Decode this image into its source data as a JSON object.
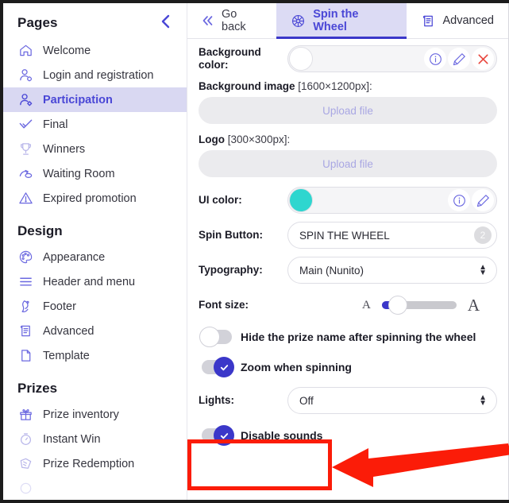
{
  "sidebar": {
    "title": "Pages",
    "collapse_icon": "chevron-left-icon",
    "groups": [
      {
        "title": "Pages",
        "items": [
          {
            "label": "Welcome",
            "icon": "home-icon",
            "active": false,
            "dim": false
          },
          {
            "label": "Login and registration",
            "icon": "user-gear-icon",
            "active": false,
            "dim": false
          },
          {
            "label": "Participation",
            "icon": "user-add-icon",
            "active": true,
            "dim": false
          },
          {
            "label": "Final",
            "icon": "check-icon",
            "active": false,
            "dim": false
          },
          {
            "label": "Winners",
            "icon": "trophy-icon",
            "active": false,
            "dim": true
          },
          {
            "label": "Waiting Room",
            "icon": "waiting-room-icon",
            "active": false,
            "dim": false
          },
          {
            "label": "Expired promotion",
            "icon": "warning-triangle-icon",
            "active": false,
            "dim": false
          }
        ]
      },
      {
        "title": "Design",
        "items": [
          {
            "label": "Appearance",
            "icon": "palette-icon",
            "active": false,
            "dim": false
          },
          {
            "label": "Header and menu",
            "icon": "menu-lines-icon",
            "active": false,
            "dim": false
          },
          {
            "label": "Footer",
            "icon": "footer-icon",
            "active": false,
            "dim": false
          },
          {
            "label": "Advanced",
            "icon": "scroll-icon",
            "active": false,
            "dim": false
          },
          {
            "label": "Template",
            "icon": "page-icon",
            "active": false,
            "dim": false
          }
        ]
      },
      {
        "title": "Prizes",
        "items": [
          {
            "label": "Prize inventory",
            "icon": "gift-icon",
            "active": false,
            "dim": false
          },
          {
            "label": "Instant Win",
            "icon": "stopwatch-icon",
            "active": false,
            "dim": true
          },
          {
            "label": "Prize Redemption",
            "icon": "ticket-icon",
            "active": false,
            "dim": true
          }
        ]
      }
    ]
  },
  "tabs": [
    {
      "label": "Go back",
      "icon": "double-chevron-left-icon",
      "active": false
    },
    {
      "label": "Spin the Wheel",
      "icon": "wheel-icon",
      "active": true
    },
    {
      "label": "Advanced",
      "icon": "scroll-icon",
      "active": false
    }
  ],
  "form": {
    "background_color": {
      "label": "Background color:",
      "swatch_hex": "#ffffff",
      "actions": [
        "info-icon",
        "edit-pencil-icon",
        "close-x-icon"
      ]
    },
    "background_image": {
      "label": "Background image",
      "dimensions": "[1600×1200px]:",
      "upload_text": "Upload file"
    },
    "logo": {
      "label": "Logo",
      "dimensions": "[300×300px]:",
      "upload_text": "Upload file"
    },
    "ui_color": {
      "label": "UI color:",
      "swatch_hex": "#2ed6cf",
      "actions": [
        "info-icon",
        "edit-pencil-icon"
      ]
    },
    "spin_button": {
      "label": "Spin Button:",
      "value": "SPIN THE WHEEL",
      "badge": "2"
    },
    "typography": {
      "label": "Typography:",
      "value": "Main (Nunito)"
    },
    "font_size": {
      "label": "Font size:",
      "small_glyph": "A",
      "large_glyph": "A",
      "percent": 12
    },
    "hide_prize_name": {
      "label": "Hide the prize name after spinning the wheel",
      "state": "off"
    },
    "zoom_when_spinning": {
      "label": "Zoom when spinning",
      "state": "on"
    },
    "lights": {
      "label": "Lights:",
      "value": "Off"
    },
    "disable_sounds": {
      "label": "Disable sounds",
      "state": "on"
    }
  },
  "annotation": {
    "highlight_color": "#fb1c08",
    "target": "disable-sounds-toggle"
  }
}
